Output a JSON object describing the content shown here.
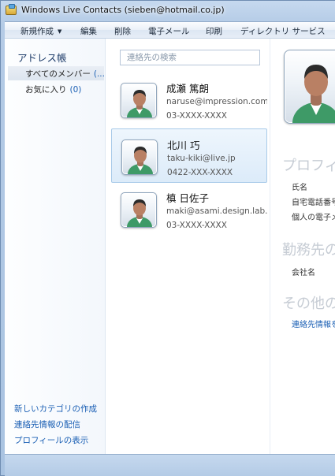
{
  "window": {
    "title": "Windows Live Contacts (sieben@hotmail.co.jp)"
  },
  "menu": {
    "items": [
      "新規作成",
      "編集",
      "削除",
      "電子メール",
      "印刷",
      "ディレクトリ サービス"
    ]
  },
  "sidebar": {
    "heading": "アドレス帳",
    "items": [
      {
        "label": "すべてのメンバー",
        "count": "(..."
      },
      {
        "label": "お気に入り",
        "count": "(0)"
      }
    ],
    "links": [
      "新しいカテゴリの作成",
      "連絡先情報の配信",
      "プロフィールの表示"
    ]
  },
  "search": {
    "placeholder": "連絡先の検索"
  },
  "contacts": [
    {
      "name": "成瀬 篤朗",
      "email": "naruse@impression.com",
      "phone": "03-XXXX-XXXX"
    },
    {
      "name": "北川 巧",
      "email": "taku-kiki@live.jp",
      "phone": "0422-XXX-XXXX"
    },
    {
      "name": "槙 日佐子",
      "email": "maki@asami.design.lab...",
      "phone": "03-XXXX-XXXX"
    }
  ],
  "detail": {
    "section_profile": "プロフィ",
    "field_name": "氏名",
    "field_home_phone": "自宅電話番号",
    "field_personal": "個人の電子メ",
    "section_work": "勤務先の",
    "field_company": "会社名",
    "section_other": "その他の",
    "link_contact_info": "連絡先情報を"
  },
  "colors": {
    "accent": "#1a5fb4",
    "frame": "#b9d1ea"
  }
}
